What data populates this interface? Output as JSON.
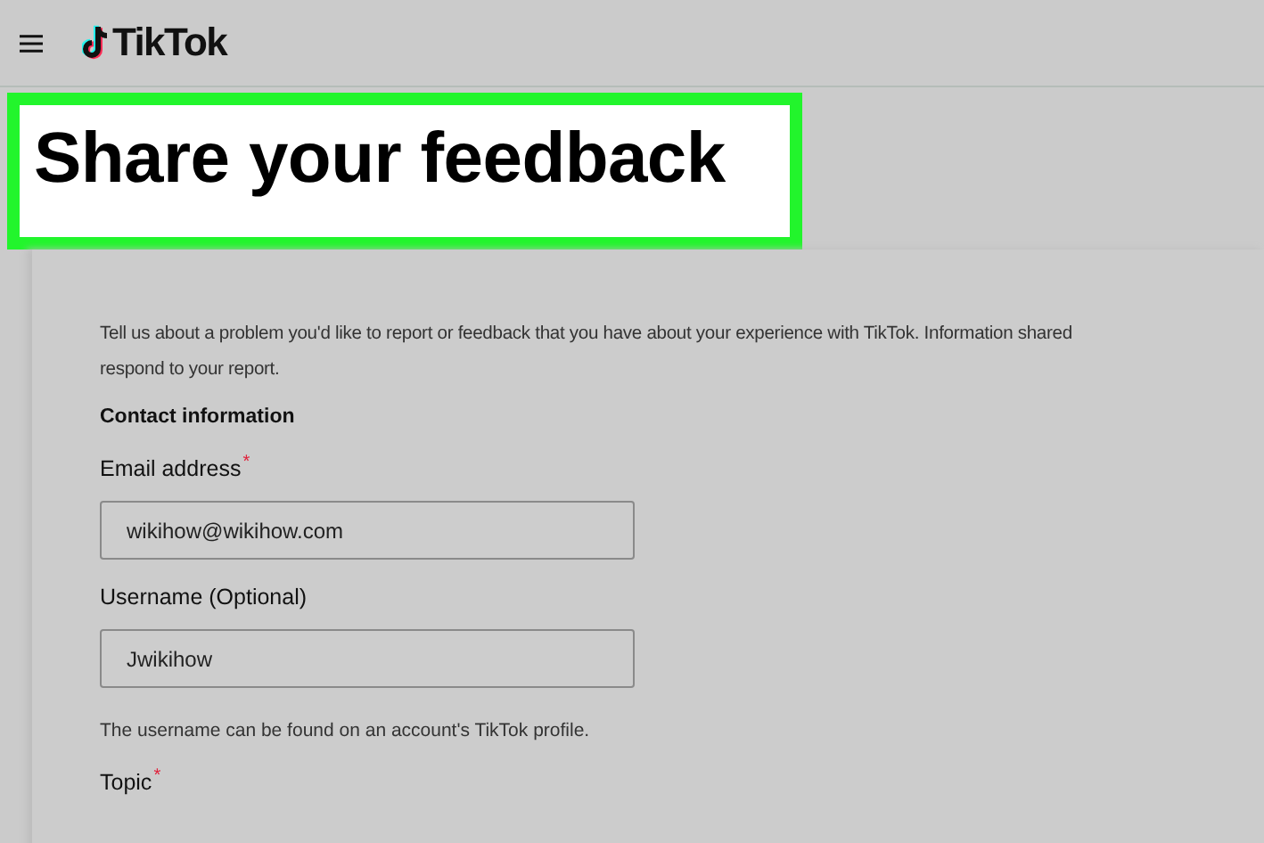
{
  "header": {
    "logo": "TikTok"
  },
  "title": "Share your feedback",
  "description": [
    "Tell us about a problem you'd like to report or feedback that you have about your experience with TikTok. Information shared",
    "respond to your report."
  ],
  "section": "Contact information",
  "fields": [
    {
      "label": "Email address",
      "required_mark": "*",
      "value": "wikihow@wikihow.com"
    },
    {
      "label": "Username (Optional)",
      "value": "Jwikihow",
      "hint": "The username can be found on an account's TikTok profile."
    },
    {
      "label": "Topic",
      "required_mark": "*"
    }
  ]
}
